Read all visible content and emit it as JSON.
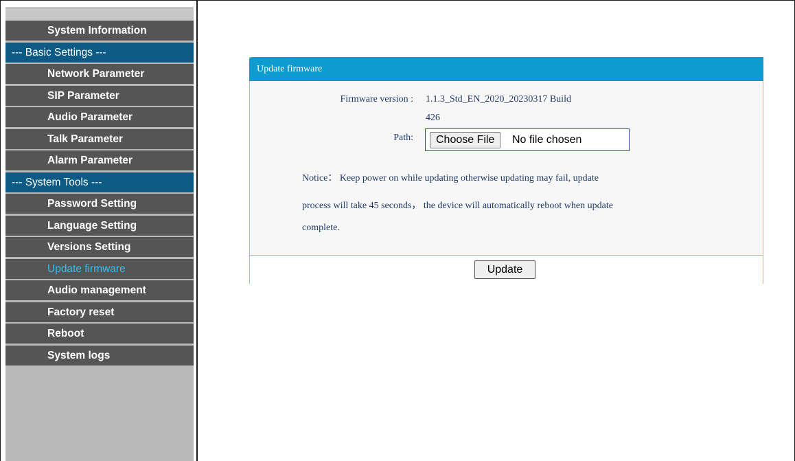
{
  "sidebar": {
    "items": [
      {
        "label": "System Information",
        "type": "link"
      },
      {
        "label": "--- Basic Settings ---",
        "type": "section"
      },
      {
        "label": "Network Parameter",
        "type": "link"
      },
      {
        "label": "SIP Parameter",
        "type": "link"
      },
      {
        "label": "Audio Parameter",
        "type": "link"
      },
      {
        "label": "Talk Parameter",
        "type": "link"
      },
      {
        "label": "Alarm Parameter",
        "type": "link"
      },
      {
        "label": "--- System Tools ---",
        "type": "section"
      },
      {
        "label": "Password Setting",
        "type": "link"
      },
      {
        "label": "Language Setting",
        "type": "link"
      },
      {
        "label": "Versions Setting",
        "type": "link"
      },
      {
        "label": "Update firmware",
        "type": "link",
        "active": true
      },
      {
        "label": "Audio management",
        "type": "link"
      },
      {
        "label": "Factory reset",
        "type": "link"
      },
      {
        "label": "Reboot",
        "type": "link"
      },
      {
        "label": "System logs",
        "type": "link"
      }
    ]
  },
  "panel": {
    "title": "Update firmware",
    "firmware_label": "Firmware version :",
    "firmware_value_line1": "1.1.3_Std_EN_2020_20230317 Build",
    "firmware_value_line2": "426",
    "path_label": "Path:",
    "choose_file_label": "Choose File",
    "file_status": "No file chosen",
    "notice_line1": "Notice： Keep power on while updating otherwise updating may fail, update",
    "notice_line2": "process will take 45 seconds， the device will automatically reboot when update",
    "notice_line3": "complete.",
    "update_button": "Update"
  },
  "colors": {
    "header_blue": "#0e9bcf",
    "section_blue": "#0d5a84",
    "active_item": "#2fc1f5",
    "panel_border": "#f0a652"
  }
}
